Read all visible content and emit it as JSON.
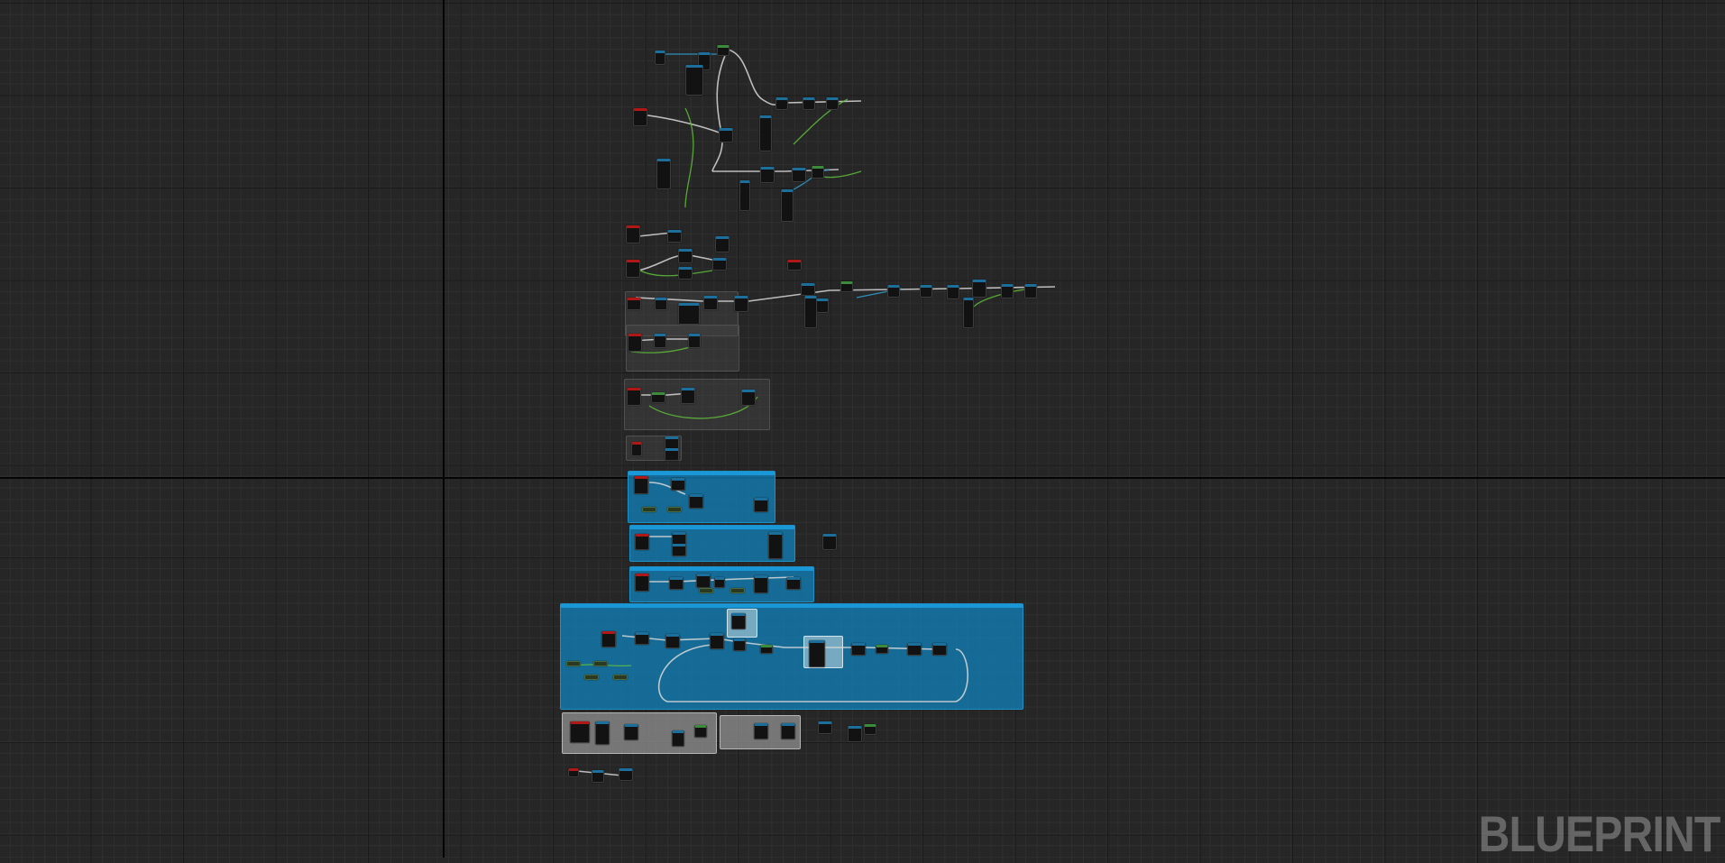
{
  "editor": {
    "graph_type_label": "BLUEPRINT",
    "colors": {
      "background": "#262626",
      "grid_major": "#1a1a1a",
      "grid_minor": "#2f2f2f",
      "comment_blue": "#127bb0",
      "comment_grey": "#969696",
      "exec_wire": "#e8e8e8",
      "data_wire_green": "#5fbf3a",
      "data_wire_blue": "#2fa3d6",
      "event_header": "#b01818",
      "function_header": "#1c6f9a"
    }
  }
}
